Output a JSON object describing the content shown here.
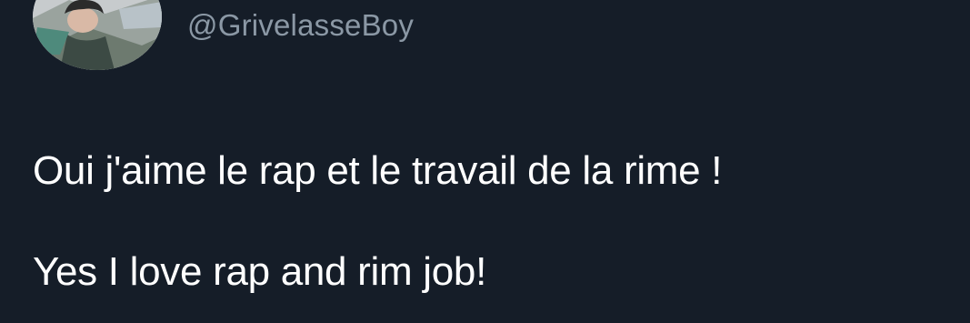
{
  "tweet": {
    "handle": "@GrivelasseBoy",
    "lines": [
      "Oui j'aime le rap et le travail de la rime !",
      "Yes I love rap and rim job!"
    ]
  },
  "colors": {
    "background": "#151d28",
    "text": "#ffffff",
    "handle": "#8b98a5"
  }
}
